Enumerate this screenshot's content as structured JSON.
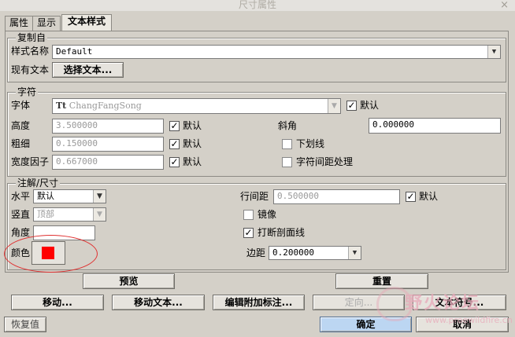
{
  "window": {
    "title": "尺寸属性",
    "close": "×"
  },
  "tabs": [
    "属性",
    "显示",
    "文本样式"
  ],
  "copy_from": {
    "group_title": "复制自",
    "style_label": "样式名称",
    "style_value": "Default",
    "existing_label": "现有文本",
    "select_text_button": "选择文本..."
  },
  "chars": {
    "group_title": "字符",
    "font_label": "字体",
    "font_value": "ChangFangSong",
    "font_icon": "Tt",
    "font_default": "默认",
    "height_label": "高度",
    "height_value": "3.500000",
    "height_default": "默认",
    "thickness_label": "粗细",
    "thickness_value": "0.150000",
    "thickness_default": "默认",
    "width_label": "宽度因子",
    "width_value": "0.667000",
    "width_default": "默认",
    "slant_label": "斜角",
    "slant_value": "0.000000",
    "underline_label": "下划线",
    "kerning_label": "字符间距处理"
  },
  "note": {
    "group_title": "注解/尺寸",
    "horizontal_label": "水平",
    "horizontal_value": "默认",
    "vertical_label": "竖直",
    "vertical_value": "顶部",
    "angle_label": "角度",
    "color_label": "颜色",
    "color_value": "#ff0000",
    "line_spacing_label": "行间距",
    "line_spacing_value": "0.500000",
    "line_spacing_default": "默认",
    "mirror_label": "镜像",
    "break_hatch_label": "打断剖面线",
    "margin_label": "边距",
    "margin_value": "0.200000"
  },
  "buttons": {
    "preview": "预览",
    "reset": "重置",
    "move": "移动...",
    "move_text": "移动文本...",
    "edit_attach": "编辑附加标注...",
    "orient": "定向...",
    "text_symbol": "文本符号...",
    "restore": "恢复值",
    "ok": "确定",
    "cancel": "取消"
  },
  "watermark": {
    "title": "野火论坛",
    "url": "www.proewildfire.cn"
  }
}
